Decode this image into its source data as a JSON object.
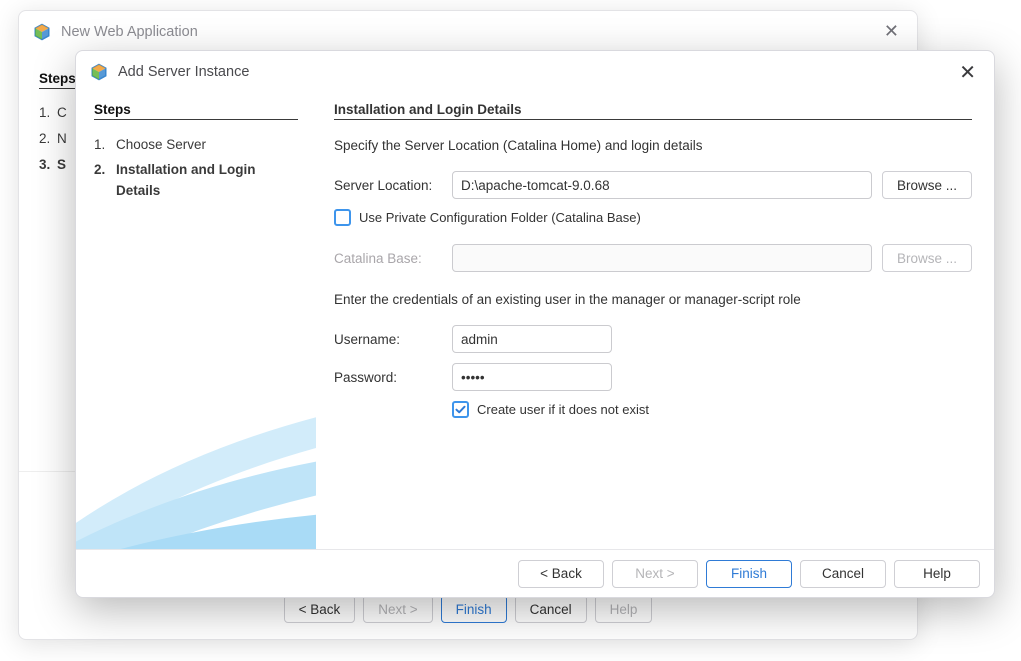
{
  "back_dialog": {
    "title": "New Web Application",
    "steps_heading": "Steps",
    "steps": [
      {
        "num": "1.",
        "label": "C",
        "current": false
      },
      {
        "num": "2.",
        "label": "N",
        "current": false
      },
      {
        "num": "3.",
        "label": "S",
        "current": true
      }
    ],
    "buttons": {
      "back": "< Back",
      "next": "Next >",
      "finish": "Finish",
      "cancel": "Cancel",
      "help": "Help"
    }
  },
  "front_dialog": {
    "title": "Add Server Instance",
    "steps_heading": "Steps",
    "steps": [
      {
        "num": "1.",
        "label": "Choose Server",
        "current": false
      },
      {
        "num": "2.",
        "label": "Installation and Login Details",
        "current": true
      }
    ],
    "section_heading": "Installation and Login Details",
    "instruction": "Specify the Server Location (Catalina Home) and login details",
    "server_location_label": "Server Location:",
    "server_location_value": "D:\\apache-tomcat-9.0.68",
    "browse_label": "Browse ...",
    "use_private_label": "Use Private Configuration Folder (Catalina Base)",
    "use_private_checked": false,
    "catalina_base_label": "Catalina Base:",
    "catalina_base_value": "",
    "credentials_instruction": "Enter the credentials of an existing user in the manager or manager-script role",
    "username_label": "Username:",
    "username_value": "admin",
    "password_label": "Password:",
    "password_value": "•••••",
    "create_user_label": "Create user if it does not exist",
    "create_user_checked": true,
    "buttons": {
      "back": "< Back",
      "next": "Next >",
      "finish": "Finish",
      "cancel": "Cancel",
      "help": "Help"
    }
  }
}
